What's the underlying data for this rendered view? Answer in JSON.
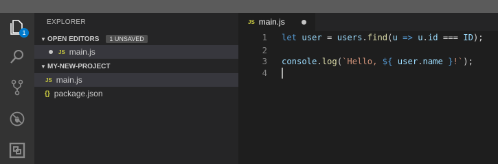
{
  "activity_bar": {
    "explorer_badge": "1"
  },
  "sidebar": {
    "title": "EXPLORER",
    "open_editors": {
      "label": "OPEN EDITORS",
      "badge": "1 UNSAVED",
      "files": [
        {
          "type_icon": "JS",
          "name": "main.js"
        }
      ]
    },
    "project": {
      "label": "MY-NEW-PROJECT",
      "files": [
        {
          "type_icon": "JS",
          "name": "main.js"
        },
        {
          "type_icon": "{}",
          "name": "package.json"
        }
      ]
    }
  },
  "editor": {
    "tab": {
      "type_icon": "JS",
      "name": "main.js"
    },
    "line_numbers": [
      "1",
      "2",
      "3",
      "4"
    ],
    "lines": [
      [
        {
          "t": "let",
          "c": "kw"
        },
        {
          "t": " ",
          "c": "op"
        },
        {
          "t": "user",
          "c": "var"
        },
        {
          "t": " = ",
          "c": "op"
        },
        {
          "t": "users",
          "c": "var"
        },
        {
          "t": ".",
          "c": "op"
        },
        {
          "t": "find",
          "c": "fn"
        },
        {
          "t": "(",
          "c": "op"
        },
        {
          "t": "u",
          "c": "var"
        },
        {
          "t": " ",
          "c": "op"
        },
        {
          "t": "=>",
          "c": "kw"
        },
        {
          "t": " ",
          "c": "op"
        },
        {
          "t": "u",
          "c": "var"
        },
        {
          "t": ".",
          "c": "op"
        },
        {
          "t": "id",
          "c": "var"
        },
        {
          "t": " === ",
          "c": "op"
        },
        {
          "t": "ID",
          "c": "var"
        },
        {
          "t": ");",
          "c": "op"
        }
      ],
      [],
      [
        {
          "t": "console",
          "c": "var"
        },
        {
          "t": ".",
          "c": "op"
        },
        {
          "t": "log",
          "c": "fn"
        },
        {
          "t": "(",
          "c": "op"
        },
        {
          "t": "`Hello, ",
          "c": "str"
        },
        {
          "t": "${",
          "c": "tmpl"
        },
        {
          "t": " user",
          "c": "var"
        },
        {
          "t": ".",
          "c": "op"
        },
        {
          "t": "name",
          "c": "var"
        },
        {
          "t": " }",
          "c": "tmpl"
        },
        {
          "t": "!`",
          "c": "str"
        },
        {
          "t": ");",
          "c": "op"
        }
      ],
      []
    ]
  }
}
